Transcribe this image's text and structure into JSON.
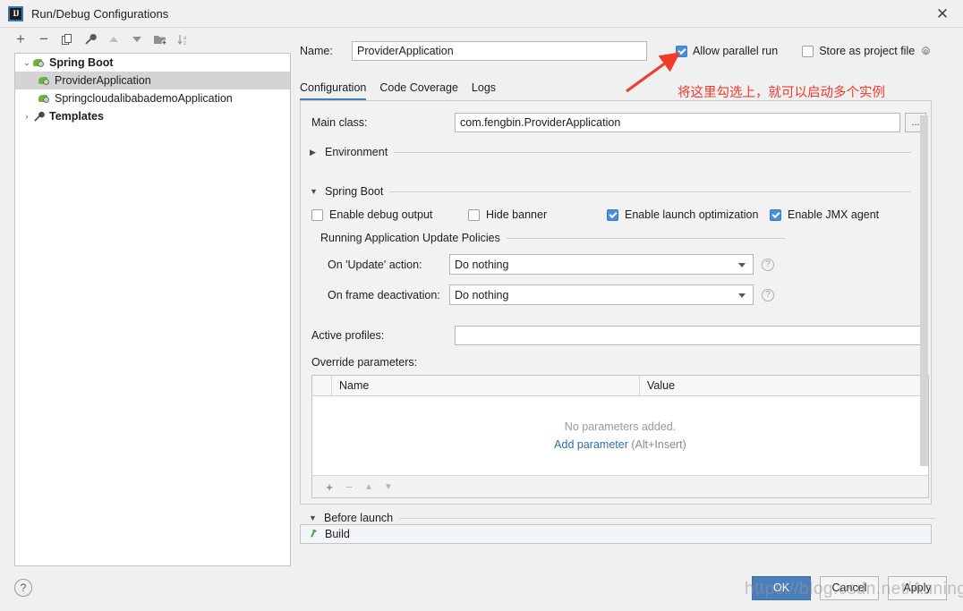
{
  "window": {
    "title": "Run/Debug Configurations",
    "app_icon": "intellij-idea-logo",
    "close_label": "✕"
  },
  "toolbar": {
    "items": [
      {
        "name": "add",
        "glyph": "+"
      },
      {
        "name": "remove",
        "glyph": "−"
      },
      {
        "name": "copy",
        "glyph": "⎘"
      },
      {
        "name": "edit-templates",
        "glyph": "🔧"
      },
      {
        "name": "move-up",
        "glyph": "▲"
      },
      {
        "name": "move-down",
        "glyph": "▼"
      },
      {
        "name": "new-folder",
        "glyph": "🗁"
      },
      {
        "name": "sort-alphabetically",
        "glyph": "↓az"
      }
    ]
  },
  "tree": {
    "nodes": [
      {
        "label": "Spring Boot",
        "icon": "spring-boot-icon",
        "twisty": "⌄",
        "bold": true,
        "selected": false,
        "indent": 0
      },
      {
        "label": "ProviderApplication",
        "icon": "spring-boot-icon",
        "twisty": "",
        "bold": false,
        "selected": true,
        "indent": 1
      },
      {
        "label": "SpringcloudalibabademoApplication",
        "icon": "spring-boot-icon",
        "twisty": "",
        "bold": false,
        "selected": false,
        "indent": 1
      },
      {
        "label": "Templates",
        "icon": "wrench-icon",
        "twisty": "›",
        "bold": true,
        "selected": false,
        "indent": 0
      }
    ]
  },
  "header": {
    "name_label": "Name:",
    "name_value": "ProviderApplication",
    "allow_parallel_run": {
      "label": "Allow parallel run",
      "checked": true
    },
    "store_as_project_file": {
      "label": "Store as project file",
      "checked": false
    },
    "gear_icon": "gear-icon"
  },
  "tabs": [
    {
      "label": "Configuration",
      "active": true
    },
    {
      "label": "Code Coverage",
      "active": false
    },
    {
      "label": "Logs",
      "active": false
    }
  ],
  "config": {
    "main_class": {
      "label": "Main class:",
      "value": "com.fengbin.ProviderApplication",
      "browse": "..."
    },
    "environment_section": {
      "title": "Environment",
      "expanded": false,
      "arrow": "▶"
    },
    "spring_boot_section": {
      "title": "Spring Boot",
      "expanded": true,
      "arrow": "▼"
    },
    "checkboxes": [
      {
        "label": "Enable debug output",
        "checked": false
      },
      {
        "label": "Hide banner",
        "checked": false
      },
      {
        "label": "Enable launch optimization",
        "checked": true
      },
      {
        "label": "Enable JMX agent",
        "checked": true
      }
    ],
    "update_policies_title": "Running Application Update Policies",
    "on_update_action": {
      "label": "On 'Update' action:",
      "value": "Do nothing"
    },
    "on_frame_deactivation": {
      "label": "On frame deactivation:",
      "value": "Do nothing"
    },
    "help_icon": "?",
    "active_profiles": {
      "label": "Active profiles:",
      "value": "",
      "placeholder": ""
    },
    "override_parameters": {
      "label": "Override parameters:",
      "columns": [
        "Name",
        "Value"
      ],
      "rows": [],
      "empty_message": "No parameters added.",
      "add_link": "Add parameter",
      "add_hint": "(Alt+Insert)",
      "footer_icons": [
        "+",
        "−",
        "▲",
        "▼"
      ]
    }
  },
  "before_launch": {
    "title": "Before launch",
    "arrow": "▼",
    "items": [
      {
        "label": "Build",
        "icon": "hammer-icon"
      }
    ]
  },
  "footer": {
    "help": "?",
    "buttons": [
      {
        "label": "OK",
        "primary": true
      },
      {
        "label": "Cancel",
        "primary": false
      },
      {
        "label": "Apply",
        "primary": false
      }
    ]
  },
  "annotation": {
    "text": "将这里勾选上，就可以启动多个实例",
    "color": "#f0392b",
    "arrow": "red-arrow-annotation"
  },
  "watermark": {
    "text": "https://blog.csdn.net/Anning_Lidi"
  }
}
